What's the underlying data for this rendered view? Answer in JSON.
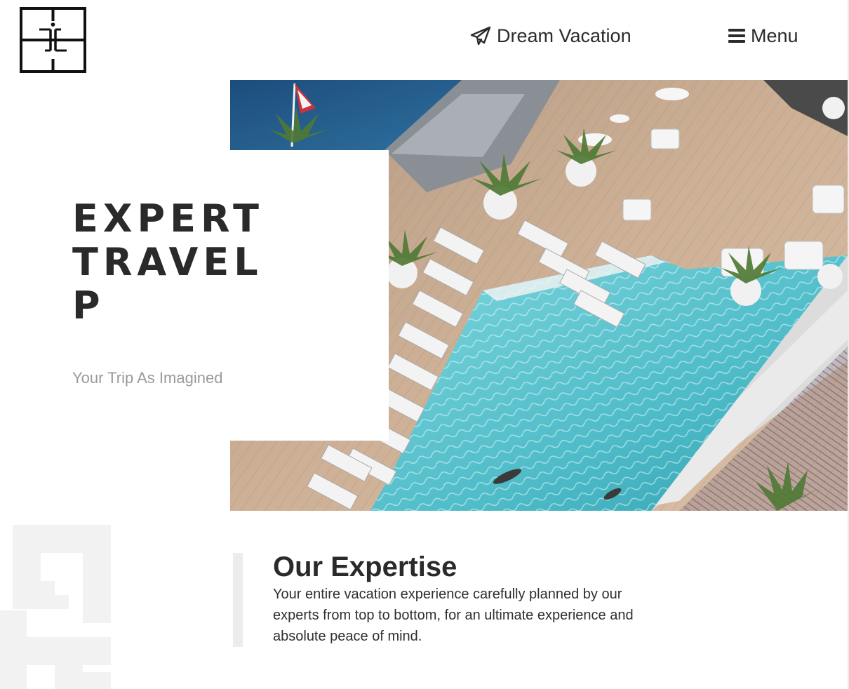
{
  "header": {
    "logo_icon": "monogram-logo-icon",
    "nav": {
      "dream_vacation": {
        "icon": "paper-plane-icon",
        "label": "Dream Vacation"
      },
      "menu": {
        "icon": "hamburger-menu-icon",
        "label": "Menu"
      }
    }
  },
  "hero": {
    "title_lines": [
      "EXPERT",
      "TRAVEL",
      "P"
    ],
    "subtitle": "Your Trip As Imagined",
    "image": "aerial-hotel-pool-deck-photo"
  },
  "expertise": {
    "title": "Our Expertise",
    "text": "Your entire vacation experience carefully planned by our experts from top to bottom, for an ultimate experience and absolute peace of mind.",
    "decoration": "greek-key-pattern"
  },
  "colors": {
    "text_dark": "#2a2a2a",
    "subtitle_gray": "#9a9a9a",
    "pool_water": "#5fc6cf",
    "deck_wood": "#c9a888",
    "sea_blue": "#1f4f7a",
    "pattern_gray": "#f2f2f2"
  }
}
